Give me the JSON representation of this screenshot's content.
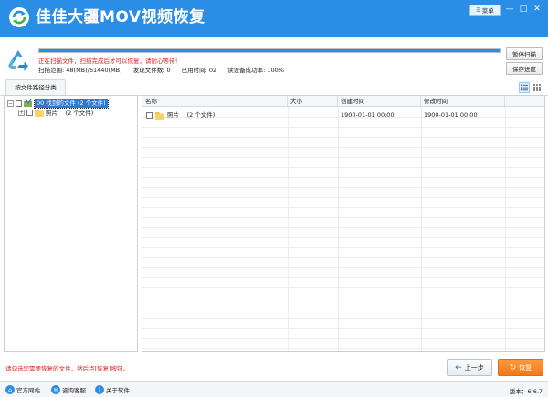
{
  "app": {
    "title": "佳佳大疆MOV视频恢复"
  },
  "titlebar": {
    "menu_label": "菜单",
    "minimize": "—",
    "maximize": "□",
    "close": "✕"
  },
  "scan": {
    "progress": 1.0,
    "status_text": "正在扫描文件，扫描完成后才可以恢复，请耐心等待！",
    "range_label": "扫描范围: 48(MB)/61440(MB)",
    "found_label": "发现文件数: 0",
    "elapsed_label": "已用时间: 02",
    "read_rate_label": "读设备成功率: 100%",
    "pause_button": "暂停扫描",
    "save_button": "保存进度"
  },
  "tabs": {
    "active": "按文件路径分类"
  },
  "tree": {
    "root_label": "00 找到的文件 (2 个文件)",
    "child_label": "照片　 (2 个文件)"
  },
  "table": {
    "columns": [
      "名称",
      "大小",
      "创建时间",
      "修改时间"
    ],
    "rows": [
      {
        "name": "照片　 (2 个文件)",
        "size": "",
        "created": "1900-01-01  00:00",
        "modified": "1900-01-01  00:00"
      }
    ]
  },
  "footer": {
    "hint": "请勾选您需要恢复的文件，然后点[恢复]按钮。",
    "prev_button": "上一步",
    "recover_button": "恢复"
  },
  "bottombar": {
    "website": "官方网站",
    "support": "咨询客服",
    "about": "关于软件",
    "version": "版本：6.6.7"
  },
  "colors": {
    "accent": "#2a8ee6",
    "warning_text": "#e02020",
    "recover_button": "#f3781a"
  }
}
